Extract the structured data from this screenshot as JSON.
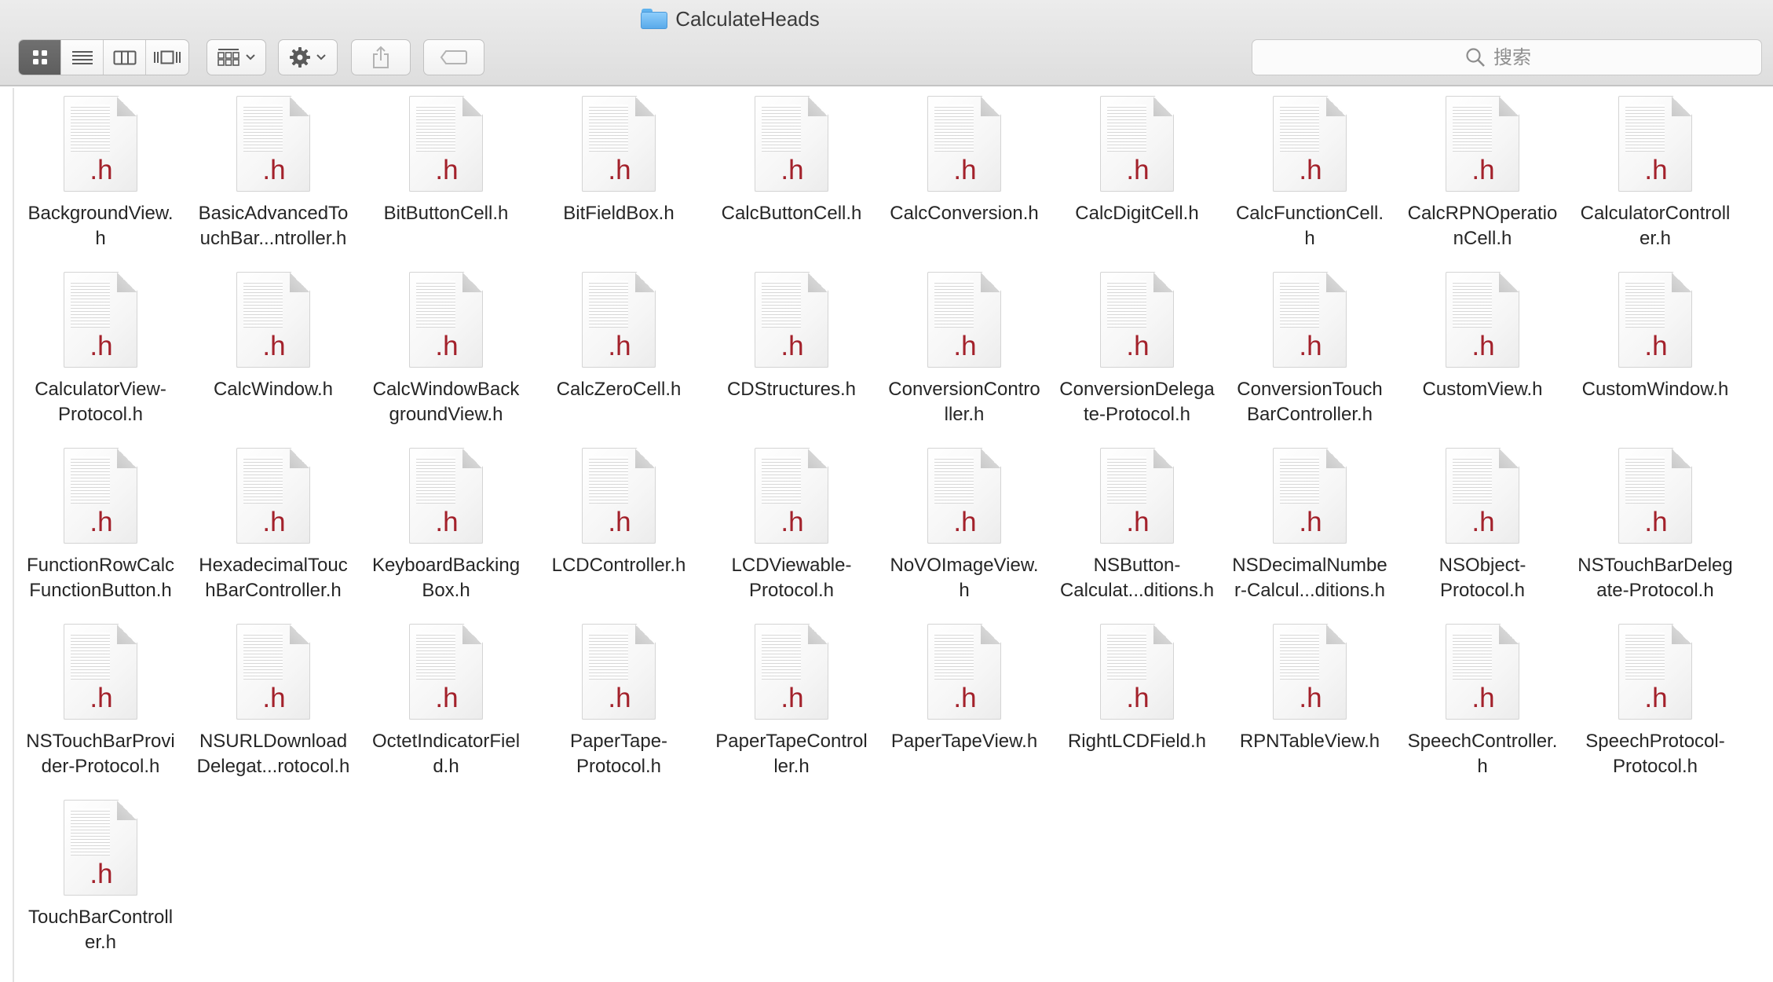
{
  "window": {
    "title": "CalculateHeads"
  },
  "search": {
    "placeholder": "搜索"
  },
  "files": [
    [
      "BackgroundView.",
      "h"
    ],
    [
      "BasicAdvancedTo",
      "uchBar...ntroller.h"
    ],
    [
      "BitButtonCell.h"
    ],
    [
      "BitFieldBox.h"
    ],
    [
      "CalcButtonCell.h"
    ],
    [
      "CalcConversion.h"
    ],
    [
      "CalcDigitCell.h"
    ],
    [
      "CalcFunctionCell.",
      "h"
    ],
    [
      "CalcRPNOperatio",
      "nCell.h"
    ],
    [
      "CalculatorControll",
      "er.h"
    ],
    [
      "CalculatorView-",
      "Protocol.h"
    ],
    [
      "CalcWindow.h"
    ],
    [
      "CalcWindowBack",
      "groundView.h"
    ],
    [
      "CalcZeroCell.h"
    ],
    [
      "CDStructures.h"
    ],
    [
      "ConversionContro",
      "ller.h"
    ],
    [
      "ConversionDelega",
      "te-Protocol.h"
    ],
    [
      "ConversionTouch",
      "BarController.h"
    ],
    [
      "CustomView.h"
    ],
    [
      "CustomWindow.h"
    ],
    [
      "FunctionRowCalc",
      "FunctionButton.h"
    ],
    [
      "HexadecimalTouc",
      "hBarController.h"
    ],
    [
      "KeyboardBacking",
      "Box.h"
    ],
    [
      "LCDController.h"
    ],
    [
      "LCDViewable-",
      "Protocol.h"
    ],
    [
      "NoVOImageView.",
      "h"
    ],
    [
      "NSButton-",
      "Calculat...ditions.h"
    ],
    [
      "NSDecimalNumbe",
      "r-Calcul...ditions.h"
    ],
    [
      "NSObject-",
      "Protocol.h"
    ],
    [
      "NSTouchBarDeleg",
      "ate-Protocol.h"
    ],
    [
      "NSTouchBarProvi",
      "der-Protocol.h"
    ],
    [
      "NSURLDownload",
      "Delegat...rotocol.h"
    ],
    [
      "OctetIndicatorFiel",
      "d.h"
    ],
    [
      "PaperTape-",
      "Protocol.h"
    ],
    [
      "PaperTapeControl",
      "ler.h"
    ],
    [
      "PaperTapeView.h"
    ],
    [
      "RightLCDField.h"
    ],
    [
      "RPNTableView.h"
    ],
    [
      "SpeechController.",
      "h"
    ],
    [
      "SpeechProtocol-",
      "Protocol.h"
    ],
    [
      "TouchBarControll",
      "er.h"
    ]
  ],
  "file_extension_badge": ".h",
  "icons": {
    "view_icon": "grid-view-icon",
    "view_list": "list-view-icon",
    "view_columns": "column-view-icon",
    "view_coverflow": "coverflow-view-icon",
    "arrange": "arrange-icon",
    "action": "gear-icon",
    "share": "share-icon",
    "tags": "tag-icon",
    "search": "search-icon",
    "folder": "folder-icon"
  },
  "colors": {
    "extension": "#a3212b",
    "folder": "#59aaea",
    "active_segment": "#666666"
  }
}
